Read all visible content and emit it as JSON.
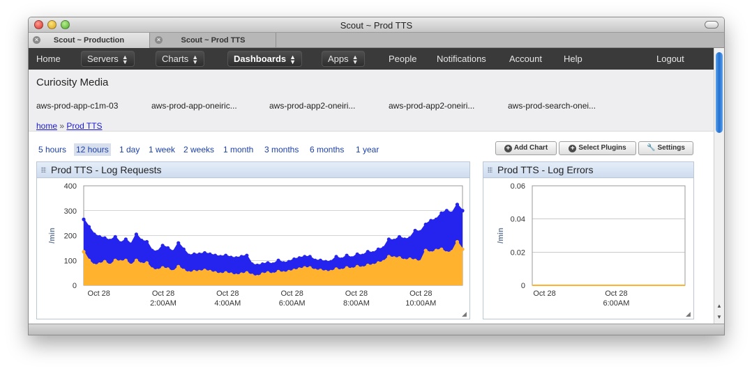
{
  "window": {
    "title": "Scout ~ Prod TTS"
  },
  "tabs": [
    {
      "label": "Scout ~ Production"
    },
    {
      "label": "Scout ~ Prod TTS"
    }
  ],
  "nav": {
    "home": "Home",
    "servers": "Servers",
    "charts": "Charts",
    "dashboards": "Dashboards",
    "apps": "Apps",
    "people": "People",
    "notifications": "Notifications",
    "account": "Account",
    "help": "Help",
    "logout": "Logout"
  },
  "account_name": "Curiosity Media",
  "servers": [
    "aws-prod-app-c1m-03",
    "aws-prod-app-oneiric...",
    "aws-prod-app2-oneiri...",
    "aws-prod-app2-oneiri...",
    "aws-prod-search-onei..."
  ],
  "breadcrumb": {
    "home": "home",
    "sep": "»",
    "current": "Prod TTS"
  },
  "ranges": [
    "5 hours",
    "12 hours",
    "1 day",
    "1 week",
    "2 weeks",
    "1 month",
    "3 months",
    "6 months",
    "1 year"
  ],
  "active_range": "12 hours",
  "buttons": {
    "add_chart": "Add Chart",
    "select_plugins": "Select Plugins",
    "settings": "Settings"
  },
  "colors": {
    "series_blue": "#2424ee",
    "series_orange": "#ffb22e",
    "nav_bg": "#3a3a3a",
    "panel_head": "#dbe6f4"
  },
  "chart_data": [
    {
      "type": "area",
      "title": "Prod TTS - Log Requests",
      "ylabel": "/min",
      "ylim": [
        0,
        400
      ],
      "yticks": [
        "0",
        "100",
        "200",
        "300",
        "400"
      ],
      "xtick_labels": [
        [
          "Oct 28",
          ""
        ],
        [
          "Oct 28",
          "2:00AM"
        ],
        [
          "Oct 28",
          "4:00AM"
        ],
        [
          "Oct 28",
          "6:00AM"
        ],
        [
          "Oct 28",
          "8:00AM"
        ],
        [
          "Oct 28",
          "10:00AM"
        ]
      ],
      "series": [
        {
          "values": [
            265,
            235,
            205,
            195,
            190,
            180,
            195,
            170,
            185,
            165,
            205,
            180,
            175,
            140,
            135,
            160,
            150,
            135,
            170,
            145,
            120,
            125,
            125,
            130,
            125,
            120,
            115,
            120,
            112,
            110,
            115,
            120,
            85,
            80,
            85,
            90,
            85,
            100,
            90,
            95,
            105,
            110,
            115,
            115,
            100,
            100,
            95,
            95,
            115,
            105,
            120,
            110,
            125,
            120,
            135,
            130,
            145,
            150,
            185,
            180,
            195,
            185,
            190,
            220,
            215,
            245,
            260,
            265,
            290,
            300,
            290,
            325,
            300
          ]
        },
        {
          "values": [
            135,
            100,
            80,
            85,
            95,
            80,
            100,
            95,
            100,
            80,
            100,
            85,
            90,
            65,
            60,
            70,
            65,
            55,
            75,
            60,
            50,
            55,
            55,
            60,
            55,
            50,
            45,
            50,
            45,
            40,
            45,
            50,
            40,
            35,
            45,
            50,
            45,
            55,
            50,
            55,
            60,
            65,
            70,
            70,
            60,
            60,
            55,
            55,
            65,
            60,
            70,
            65,
            75,
            70,
            80,
            80,
            90,
            95,
            115,
            110,
            110,
            100,
            105,
            100,
            95,
            140,
            130,
            140,
            145,
            130,
            135,
            175,
            145
          ]
        }
      ]
    },
    {
      "type": "area",
      "title": "Prod TTS - Log Errors",
      "ylabel": "/min",
      "ylim": [
        0,
        0.06
      ],
      "yticks": [
        "0",
        "0.02",
        "0.04",
        "0.06"
      ],
      "xtick_labels": [
        [
          "Oct 28",
          ""
        ],
        [
          "Oct 28",
          "6:00AM"
        ]
      ],
      "series": [
        {
          "values": [
            0,
            0
          ]
        }
      ]
    }
  ]
}
